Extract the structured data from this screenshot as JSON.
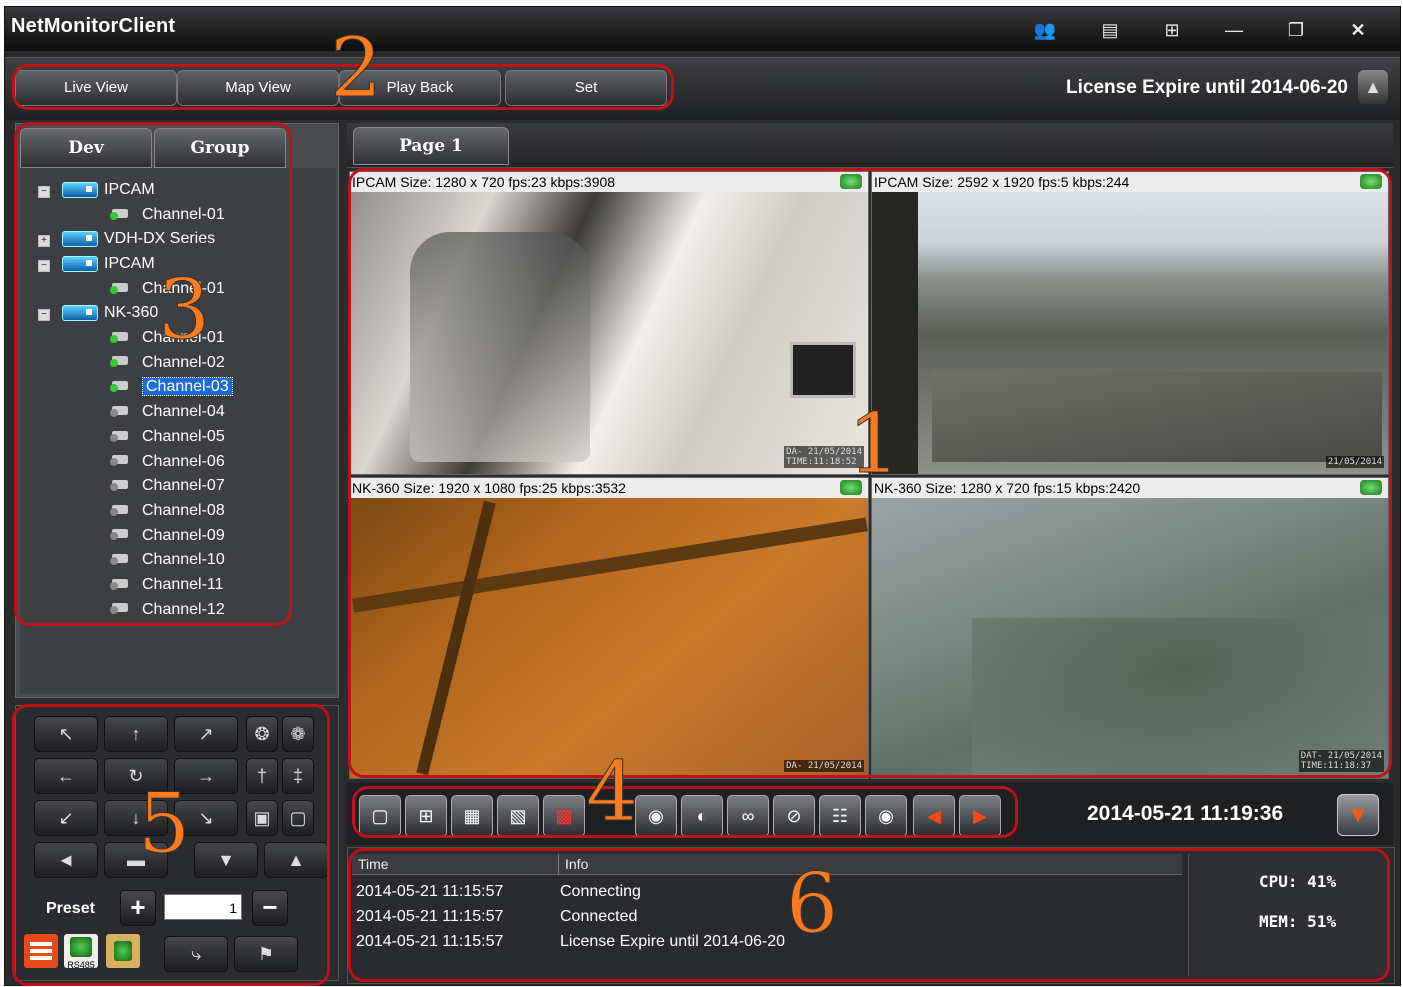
{
  "window": {
    "title": "NetMonitorClient"
  },
  "top_tabs": [
    "Live View",
    "Map View",
    "Play Back",
    "Set"
  ],
  "license_text": "License Expire until 2014-06-20",
  "left_tabs": {
    "dev": "Dev",
    "group": "Group"
  },
  "tree": {
    "ipcam1": "IPCAM",
    "ipcam1_ch": "Channel-01",
    "vdh": "VDH-DX Series",
    "ipcam2": "IPCAM",
    "ipcam2_ch": "Channel-01",
    "nk": "NK-360",
    "nk_channels": [
      "Channel-01",
      "Channel-02",
      "Channel-03",
      "Channel-04",
      "Channel-05",
      "Channel-06",
      "Channel-07",
      "Channel-08",
      "Channel-09",
      "Channel-10",
      "Channel-11",
      "Channel-12"
    ],
    "selected": "Channel-03"
  },
  "page_tab": "Page 1",
  "videos": [
    {
      "header": "IPCAM Size: 1280 x 720 fps:23 kbps:3908",
      "osd1": "DA- 21/05/2014",
      "osd2": "TIME:11:18:52"
    },
    {
      "header": "IPCAM Size: 2592 x 1920 fps:5 kbps:244",
      "osd1": "21/05/2014",
      "osd2": ""
    },
    {
      "header": "NK-360 Size: 1920 x 1080 fps:25 kbps:3532",
      "osd1": "DA- 21/05/2014",
      "osd2": ""
    },
    {
      "header": "NK-360 Size: 1280 x 720 fps:15 kbps:2420",
      "osd1": "DAT- 21/05/2014",
      "osd2": "TIME:11:18:37"
    }
  ],
  "ptz": {
    "preset_label": "Preset",
    "preset_value": "1",
    "rs485_label": "RS485"
  },
  "clock": "2014-05-21 11:19:36",
  "log": {
    "headers": {
      "time": "Time",
      "info": "Info"
    },
    "rows": [
      {
        "time": "2014-05-21 11:15:57",
        "info": "Connecting"
      },
      {
        "time": "2014-05-21 11:15:57",
        "info": "Connected"
      },
      {
        "time": "2014-05-21 11:15:57",
        "info": "License Expire until 2014-06-20"
      }
    ]
  },
  "stats": {
    "cpu_label": "CPU:",
    "cpu_value": "41%",
    "mem_label": "MEM:",
    "mem_value": "51%"
  },
  "annotations": [
    "1",
    "2",
    "3",
    "4",
    "5",
    "6"
  ],
  "colors": {
    "annotation_box": "#c0101a",
    "annotation_number": "#ff7a1a",
    "selection": "#1d6cd6"
  }
}
